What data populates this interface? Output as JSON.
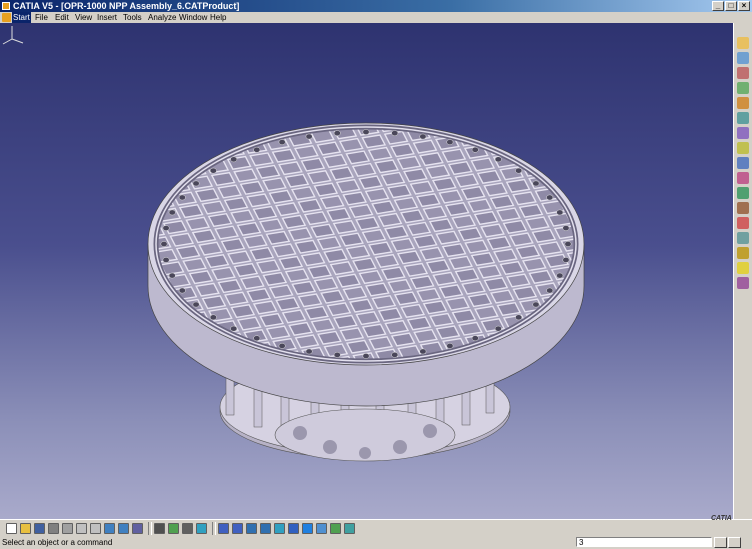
{
  "window": {
    "title": "CATIA V5 - [OPR-1000 NPP Assembly_6.CATProduct]",
    "minimize": "_",
    "maximize": "□",
    "close": "×"
  },
  "menu": {
    "items": [
      "Start",
      "File",
      "Edit",
      "View",
      "Insert",
      "Tools",
      "Analyze",
      "Window",
      "Help"
    ],
    "active": "Start"
  },
  "viewport": {
    "background_top": "#2e3370",
    "background_bottom": "#a9aacb",
    "model_color": "#c7c4d6",
    "compass_icon": "axis-compass-icon"
  },
  "right_toolbar": {
    "icons": [
      "sketch-icon",
      "assembly-icon",
      "part-icon",
      "product-icon",
      "constraint-icon",
      "fix-icon",
      "contact-icon",
      "offset-icon",
      "angle-icon",
      "snap-icon",
      "move-icon",
      "explode-icon",
      "clash-icon",
      "measure-icon",
      "update-icon",
      "light-icon",
      "scene-icon"
    ]
  },
  "bottom_toolbar": {
    "icons": [
      "new-icon",
      "open-icon",
      "save-icon",
      "print-icon",
      "cut-icon",
      "copy-icon",
      "paste-icon",
      "undo-icon",
      "redo-icon",
      "whats-this-icon",
      "formula-icon",
      "catalog-icon",
      "knowledge-icon",
      "fly-icon",
      "pan-icon",
      "rotate-icon",
      "zoom-in-icon",
      "zoom-out-icon",
      "normal-view-icon",
      "iso-view-icon",
      "shading-icon",
      "hide-show-icon",
      "swap-icon",
      "render-icon"
    ]
  },
  "status": {
    "message": "Select an object or a command",
    "command_value": "3"
  },
  "branding": {
    "logo_text": "CATIA"
  },
  "colors": {
    "title_active": "#0a246a",
    "chrome": "#d4d0c8"
  }
}
